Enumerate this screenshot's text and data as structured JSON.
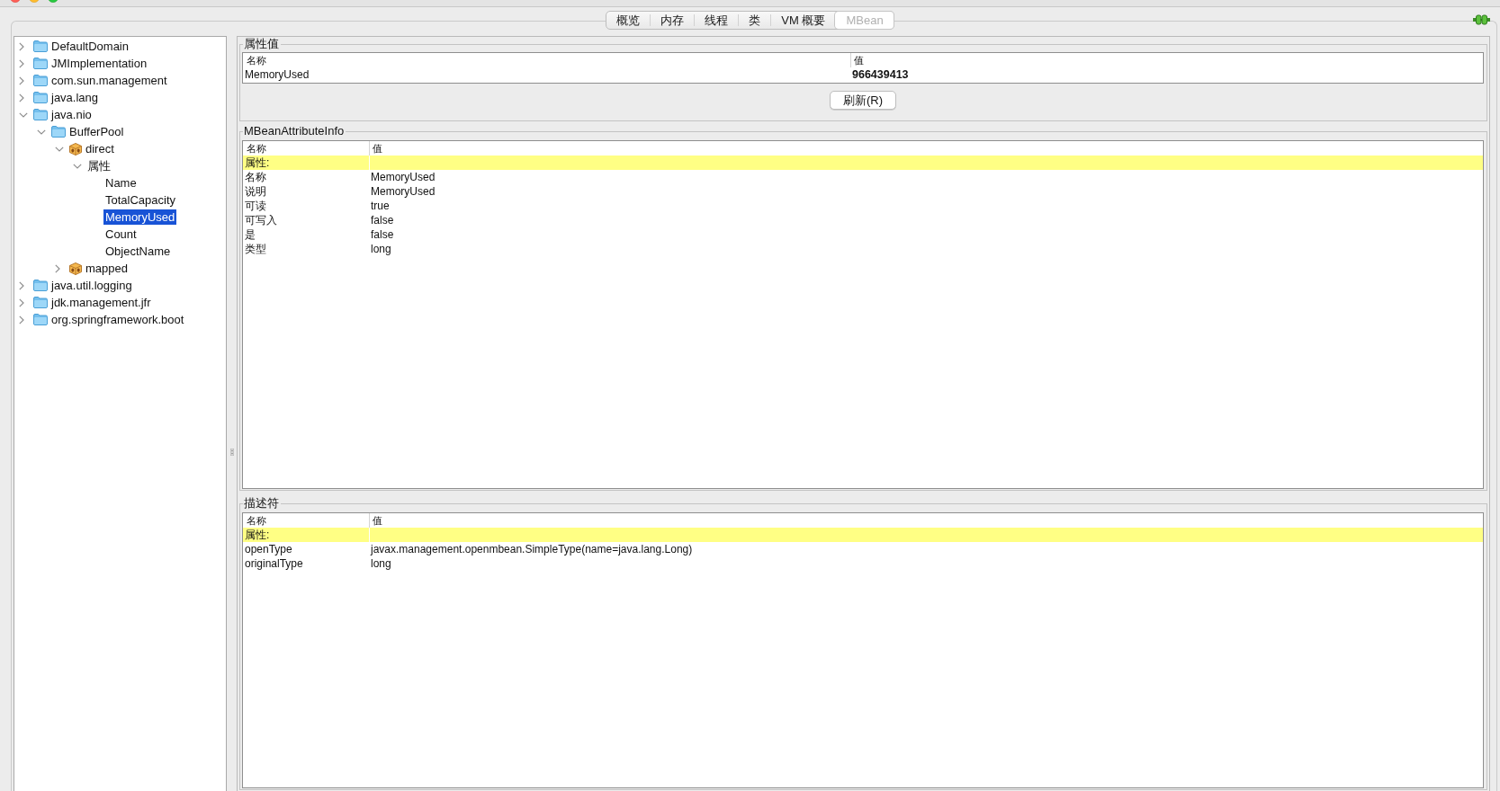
{
  "tabs": [
    {
      "label": "概览",
      "selected": false
    },
    {
      "label": "内存",
      "selected": false
    },
    {
      "label": "线程",
      "selected": false
    },
    {
      "label": "类",
      "selected": false
    },
    {
      "label": "VM 概要",
      "selected": false
    },
    {
      "label": "MBean",
      "selected": true
    }
  ],
  "tree": [
    {
      "label": "DefaultDomain",
      "kind": "folder",
      "expanded": false,
      "selected": false
    },
    {
      "label": "JMImplementation",
      "kind": "folder",
      "expanded": false,
      "selected": false
    },
    {
      "label": "com.sun.management",
      "kind": "folder",
      "expanded": false,
      "selected": false
    },
    {
      "label": "java.lang",
      "kind": "folder",
      "expanded": false,
      "selected": false
    },
    {
      "label": "java.nio",
      "kind": "folder",
      "expanded": true,
      "selected": false,
      "children": [
        {
          "label": "BufferPool",
          "kind": "folder",
          "expanded": true,
          "selected": false,
          "children": [
            {
              "label": "direct",
              "kind": "bean",
              "expanded": true,
              "selected": false,
              "children": [
                {
                  "label": "属性",
                  "expanded": true,
                  "selected": false,
                  "children": [
                    {
                      "label": "Name",
                      "selected": false
                    },
                    {
                      "label": "TotalCapacity",
                      "selected": false
                    },
                    {
                      "label": "MemoryUsed",
                      "selected": true
                    },
                    {
                      "label": "Count",
                      "selected": false
                    },
                    {
                      "label": "ObjectName",
                      "selected": false
                    }
                  ]
                }
              ]
            },
            {
              "label": "mapped",
              "kind": "bean",
              "expanded": false,
              "selected": false
            }
          ]
        }
      ]
    },
    {
      "label": "java.util.logging",
      "kind": "folder",
      "expanded": false,
      "selected": false
    },
    {
      "label": "jdk.management.jfr",
      "kind": "folder",
      "expanded": false,
      "selected": false
    },
    {
      "label": "org.springframework.boot",
      "kind": "folder",
      "expanded": false,
      "selected": false
    }
  ],
  "attribute_values": {
    "title": "属性值",
    "columns": [
      "名称",
      "值"
    ],
    "rows": [
      {
        "kind": "data",
        "cells": [
          "MemoryUsed",
          "966439413"
        ]
      }
    ],
    "refresh_button": "刷新(R)"
  },
  "attribute_info": {
    "title": "MBeanAttributeInfo",
    "columns": [
      "名称",
      "值"
    ],
    "rows": [
      {
        "kind": "section",
        "label": "属性:"
      },
      {
        "kind": "data",
        "cells": [
          "名称",
          "MemoryUsed"
        ]
      },
      {
        "kind": "data",
        "cells": [
          "说明",
          "MemoryUsed"
        ]
      },
      {
        "kind": "data",
        "cells": [
          "可读",
          "true"
        ]
      },
      {
        "kind": "data",
        "cells": [
          "可写入",
          "false"
        ]
      },
      {
        "kind": "data",
        "cells": [
          "是",
          "false"
        ]
      },
      {
        "kind": "data",
        "cells": [
          "类型",
          "long"
        ]
      }
    ]
  },
  "descriptor": {
    "title": "描述符",
    "columns": [
      "名称",
      "值"
    ],
    "rows": [
      {
        "kind": "section",
        "label": "属性:"
      },
      {
        "kind": "data",
        "cells": [
          "openType",
          "javax.management.openmbean.SimpleType(name=java.lang.Long)"
        ]
      },
      {
        "kind": "data",
        "cells": [
          "originalType",
          "long"
        ]
      }
    ]
  }
}
